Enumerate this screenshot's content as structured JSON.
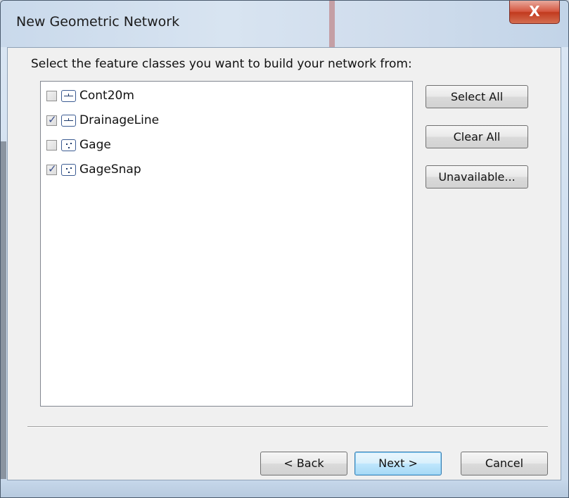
{
  "window": {
    "title": "New Geometric Network",
    "close_glyph": "X"
  },
  "prompt": "Select the feature classes you want to build your network from:",
  "feature_classes": [
    {
      "name": "Cont20m",
      "checked": false,
      "icon": "line-feature-icon"
    },
    {
      "name": "DrainageLine",
      "checked": true,
      "icon": "line-feature-icon"
    },
    {
      "name": "Gage",
      "checked": false,
      "icon": "point-feature-icon"
    },
    {
      "name": "GageSnap",
      "checked": true,
      "icon": "point-feature-icon"
    }
  ],
  "side_buttons": {
    "select_all": "Select All",
    "clear_all": "Clear All",
    "unavailable": "Unavailable..."
  },
  "footer_buttons": {
    "back": "< Back",
    "next": "Next >",
    "cancel": "Cancel"
  }
}
